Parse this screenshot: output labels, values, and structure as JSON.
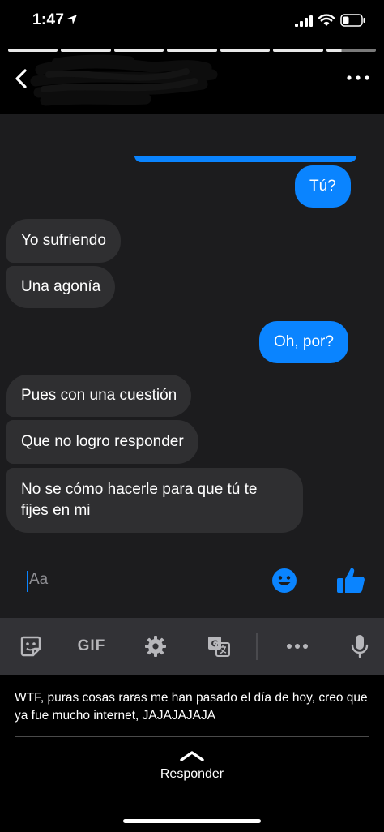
{
  "status_bar": {
    "time": "1:47"
  },
  "story": {
    "segments": 7
  },
  "header": {
    "contact_name": ""
  },
  "messages": [
    {
      "id": "m0",
      "side": "out",
      "text": "Tú?"
    },
    {
      "id": "m1",
      "side": "in",
      "text": "Yo sufriendo"
    },
    {
      "id": "m2",
      "side": "in",
      "text": "Una agonía"
    },
    {
      "id": "m3",
      "side": "out",
      "text": "Oh, por?"
    },
    {
      "id": "m4",
      "side": "in",
      "text": "Pues con una cuestión"
    },
    {
      "id": "m5",
      "side": "in",
      "text": "Que no logro responder"
    },
    {
      "id": "m6",
      "side": "in",
      "text": "No se cómo hacerle para que tú te fijes en mi"
    }
  ],
  "composer": {
    "placeholder": "Aa"
  },
  "keyboard_toolbar": {
    "gif_label": "GIF"
  },
  "reply": {
    "caption": "WTF, puras cosas raras me han pasado el día de hoy, creo que ya fue mucho internet, JAJAJAJAJA",
    "action_label": "Responder"
  },
  "colors": {
    "accent": "#0a84ff",
    "incoming_bubble": "#2f2f31",
    "chat_bg": "#1c1c1e",
    "toolbar_bg": "#323236"
  },
  "icons": [
    "location-arrow-icon",
    "signal-icon",
    "wifi-icon",
    "battery-icon",
    "back-chevron-icon",
    "more-icon",
    "emoji-icon",
    "thumbs-up-icon",
    "sticker-icon",
    "gear-icon",
    "translate-icon",
    "more-horizontal-icon",
    "microphone-icon",
    "chevron-up-icon"
  ]
}
